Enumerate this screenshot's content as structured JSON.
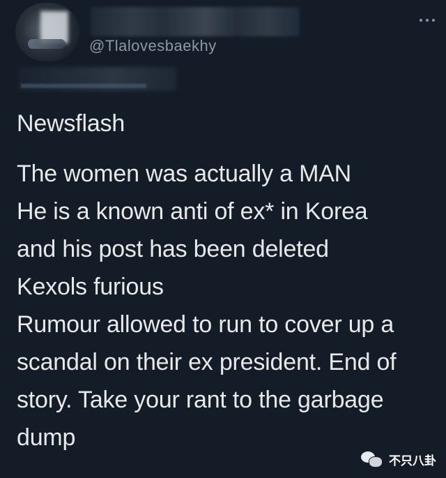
{
  "tweet": {
    "handle": "@Tlalovesbaekhy",
    "lines": [
      "Newsflash",
      "",
      "The women was actually a MAN",
      "He is a known anti of ex* in Korea",
      "and his post has been deleted",
      "Kexols furious",
      "Rumour allowed to run to cover up a",
      "scandal on their ex president. End of",
      "story. Take your rant to the garbage",
      "dump"
    ]
  },
  "watermark": {
    "text": "不只八卦"
  },
  "icons": {
    "more": "more-horizontal-icon",
    "wechat": "wechat-icon"
  },
  "colors": {
    "background": "#131c27",
    "text": "#e7e9ea",
    "secondary": "#8b98a5"
  }
}
